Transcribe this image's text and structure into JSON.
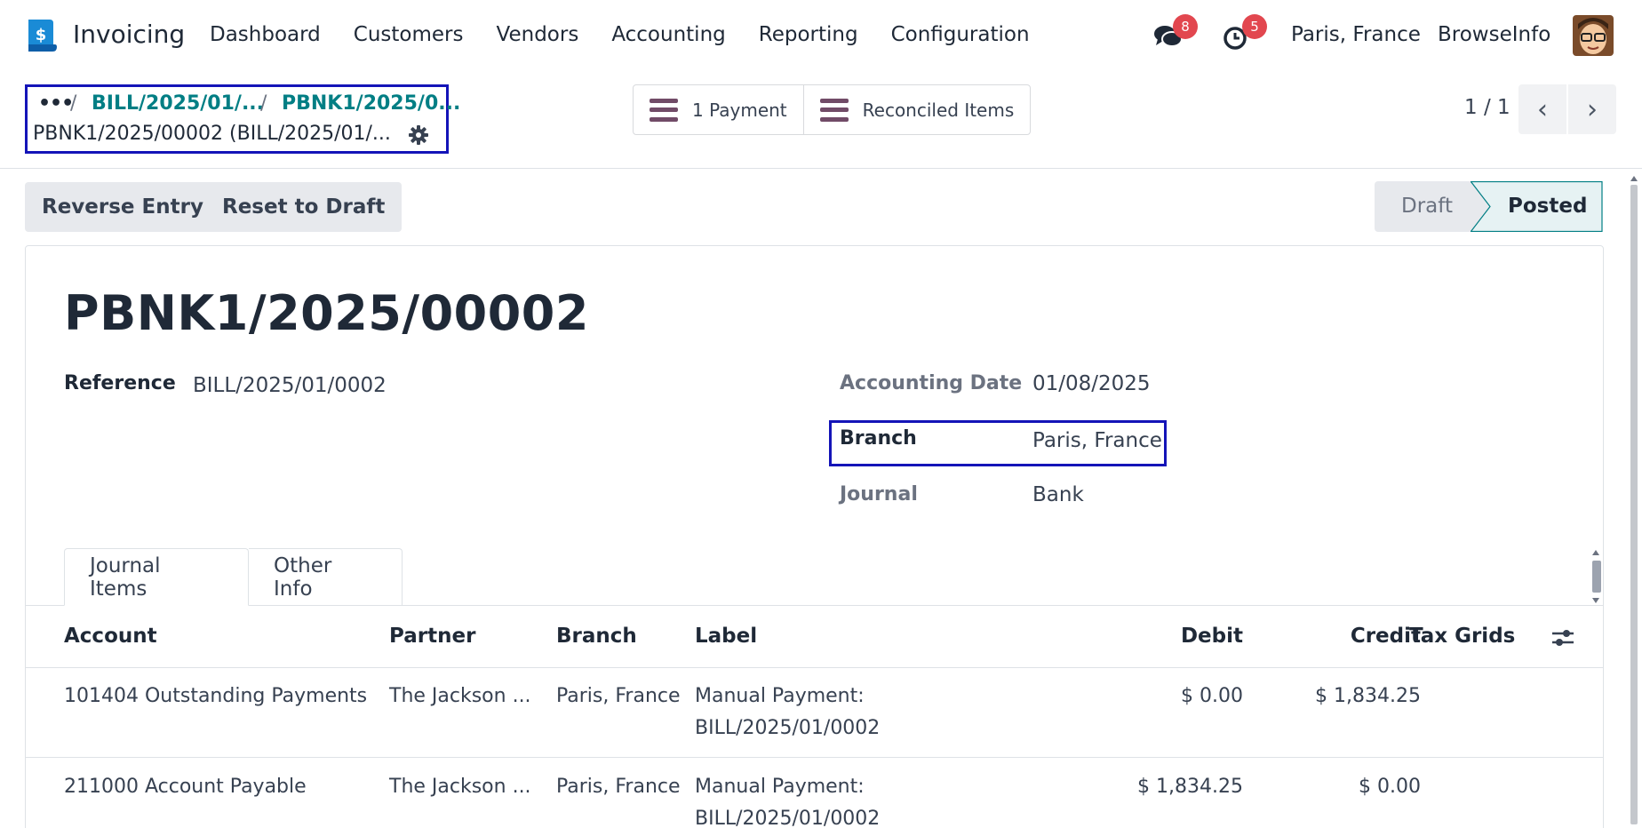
{
  "navbar": {
    "app_name": "Invoicing",
    "menu": [
      "Dashboard",
      "Customers",
      "Vendors",
      "Accounting",
      "Reporting",
      "Configuration"
    ],
    "messages_count": "8",
    "activities_count": "5",
    "branch": "Paris, France",
    "company": "BrowseInfo",
    "icons": [
      "invoicing-app-icon",
      "chat-icon",
      "clock-icon",
      "avatar"
    ]
  },
  "breadcrumb": {
    "dots": "•••",
    "items": [
      "BILL/2025/01/...",
      "PBNK1/2025/0..."
    ],
    "current": "PBNK1/2025/00002 (BILL/2025/01/..."
  },
  "smart_buttons": {
    "payment": "1 Payment",
    "reconciled": "Reconciled Items"
  },
  "pager": {
    "value": "1 / 1",
    "prev": "‹",
    "next": "›"
  },
  "actions": {
    "reverse": "Reverse Entry",
    "reset": "Reset to Draft"
  },
  "status": {
    "stages": [
      "Draft",
      "Posted"
    ],
    "current": "Posted"
  },
  "record": {
    "title": "PBNK1/2025/00002",
    "reference_label": "Reference",
    "reference": "BILL/2025/01/0002",
    "date_label": "Accounting Date",
    "date": "01/08/2025",
    "branch_label": "Branch",
    "branch": "Paris, France",
    "journal_label": "Journal",
    "journal": "Bank"
  },
  "tabs": [
    "Journal Items",
    "Other Info"
  ],
  "table": {
    "headers": [
      "Account",
      "Partner",
      "Branch",
      "Label",
      "Debit",
      "Credit",
      "Tax Grids"
    ],
    "rows": [
      {
        "account": "101404 Outstanding Payments",
        "partner": "The Jackson ...",
        "branch": "Paris, France",
        "label_line1": "Manual Payment:",
        "label_line2": "BILL/2025/01/0002",
        "debit": "$ 0.00",
        "credit": "$ 1,834.25"
      },
      {
        "account": "211000 Account Payable",
        "partner": "The Jackson ...",
        "branch": "Paris, France",
        "label_line1": "Manual Payment:",
        "label_line2": "BILL/2025/01/0002",
        "debit": "$ 1,834.25",
        "credit": "$ 0.00"
      }
    ]
  },
  "colors": {
    "accent": "#714b67",
    "link": "#017e84",
    "highlight_box": "#1414b8",
    "badge": "#e2474f"
  }
}
